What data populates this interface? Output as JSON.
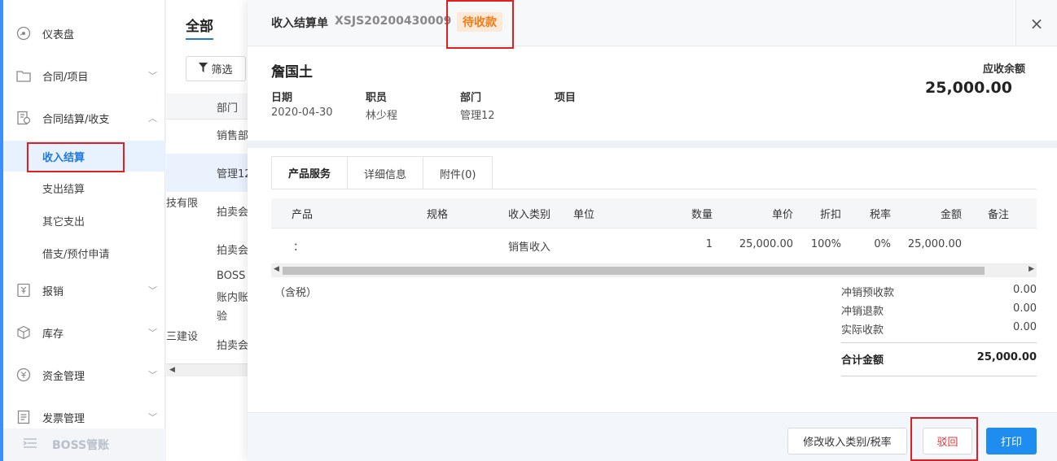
{
  "sidebar": {
    "items": [
      {
        "label": "仪表盘",
        "icon": "dashboard-icon"
      },
      {
        "label": "合同/项目",
        "icon": "folder-icon"
      },
      {
        "label": "合同结算/收支",
        "icon": "settlement-icon"
      },
      {
        "label": "报销",
        "icon": "reimburse-icon"
      },
      {
        "label": "库存",
        "icon": "box-icon"
      },
      {
        "label": "资金管理",
        "icon": "funds-icon"
      },
      {
        "label": "发票管理",
        "icon": "invoice-icon"
      }
    ],
    "subitems": [
      "收入结算",
      "支出结算",
      "其它支出",
      "借支/预付申请"
    ],
    "footer_label": "BOSS管账"
  },
  "list": {
    "tab_all": "全部",
    "filter_label": "筛选",
    "column_header": "部门",
    "rows": [
      "销售部",
      "管理12",
      "拍卖会",
      "拍卖会",
      "BOSS",
      "账内账",
      "验",
      "拍卖会"
    ],
    "left_fragments": [
      "技有限",
      "三建设"
    ]
  },
  "drawer": {
    "title": "收入结算单",
    "code": "XSJS20200430009",
    "status": "待收款",
    "close": "×",
    "customer": "詹国土",
    "fields": [
      {
        "label": "日期",
        "value": "2020-04-30"
      },
      {
        "label": "职员",
        "value": "林少程"
      },
      {
        "label": "部门",
        "value": "管理12"
      },
      {
        "label": "项目",
        "value": ""
      }
    ],
    "balance_label": "应收余额",
    "balance_value": "25,000.00",
    "tabs": [
      "产品服务",
      "详细信息",
      "附件(0)"
    ],
    "table": {
      "headers": [
        "产品",
        "规格",
        "收入类别",
        "单位",
        "数量",
        "单价",
        "折扣",
        "税率",
        "金额",
        "备注"
      ],
      "rows": [
        {
          "product": "：",
          "spec": "",
          "category": "销售收入",
          "unit": "",
          "qty": "1",
          "price": "25,000.00",
          "discount": "100%",
          "tax": "0%",
          "amount": "25,000.00",
          "note": ""
        }
      ]
    },
    "tax_note": "（含税）",
    "summary": [
      {
        "label": "冲销预收款",
        "value": "0.00"
      },
      {
        "label": "冲销退款",
        "value": "0.00"
      },
      {
        "label": "实际收款",
        "value": "0.00"
      }
    ],
    "total_label": "合计金额",
    "total_value": "25,000.00",
    "buttons": {
      "modify": "修改收入类别/税率",
      "reject": "驳回",
      "print": "打印"
    }
  },
  "colors": {
    "accent": "#1f8cf0",
    "status": "#f07d1a",
    "highlight_box": "#e02020"
  }
}
